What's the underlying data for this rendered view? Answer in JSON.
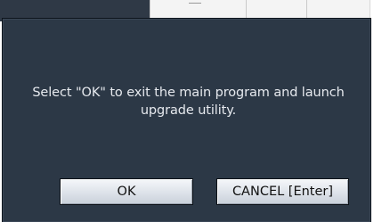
{
  "dialog": {
    "message": "Select \"OK\" to exit the main program and launch upgrade utility.",
    "ok_label": "OK",
    "cancel_label": "CANCEL [Enter]"
  }
}
